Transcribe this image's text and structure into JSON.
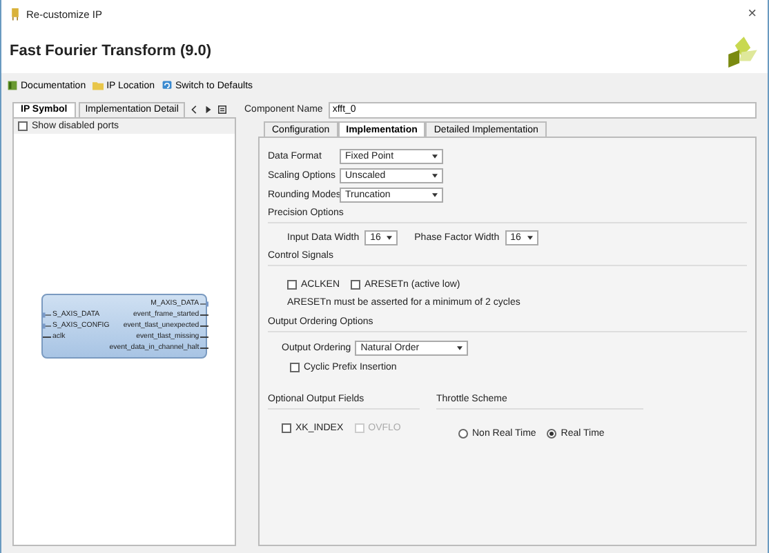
{
  "window": {
    "title": "Re-customize IP",
    "close": "×"
  },
  "header": {
    "title": "Fast Fourier Transform (9.0)"
  },
  "toolbar": [
    {
      "label": "Documentation"
    },
    {
      "label": "IP Location"
    },
    {
      "label": "Switch to Defaults"
    }
  ],
  "left_panel": {
    "tabs": [
      {
        "label": "IP Symbol",
        "selected": true
      },
      {
        "label": "Implementation Detail",
        "selected": false
      }
    ],
    "show_disabled_ports": {
      "label": "Show disabled ports",
      "checked": false
    },
    "symbol": {
      "left_ports": [
        {
          "label": "S_AXIS_DATA",
          "kind": "bus"
        },
        {
          "label": "S_AXIS_CONFIG",
          "kind": "bus"
        },
        {
          "label": "aclk",
          "kind": "wire"
        }
      ],
      "right_ports": [
        {
          "label": "M_AXIS_DATA",
          "kind": "bus"
        },
        {
          "label": "event_frame_started",
          "kind": "wire"
        },
        {
          "label": "event_tlast_unexpected",
          "kind": "wire"
        },
        {
          "label": "event_tlast_missing",
          "kind": "wire"
        },
        {
          "label": "event_data_in_channel_halt",
          "kind": "wire"
        }
      ]
    }
  },
  "component_name": {
    "label": "Component Name",
    "value": "xfft_0"
  },
  "tabs": [
    {
      "label": "Configuration",
      "selected": false
    },
    {
      "label": "Implementation",
      "selected": true
    },
    {
      "label": "Detailed Implementation",
      "selected": false
    }
  ],
  "dropdowns": [
    {
      "label": "Data Format",
      "value": "Fixed Point"
    },
    {
      "label": "Scaling Options",
      "value": "Unscaled"
    },
    {
      "label": "Rounding Modes",
      "value": "Truncation"
    }
  ],
  "precision_options": {
    "title": "Precision Options",
    "fields": [
      {
        "label": "Input Data Width",
        "value": "16"
      },
      {
        "label": "Phase Factor Width",
        "value": "16"
      }
    ]
  },
  "control_signals": {
    "title": "Control Signals",
    "checkboxes": [
      {
        "label": "ACLKEN",
        "checked": false,
        "disabled": false
      },
      {
        "label": "ARESETn (active low)",
        "checked": false,
        "disabled": false
      }
    ],
    "note": "ARESETn must be asserted for a minimum of 2 cycles"
  },
  "output_ordering": {
    "title": "Output Ordering Options",
    "label": "Output Ordering",
    "value": "Natural Order",
    "checkbox": {
      "label": "Cyclic Prefix Insertion",
      "checked": false,
      "disabled": false
    }
  },
  "optional_output_fields": {
    "title": "Optional Output Fields",
    "checkboxes": [
      {
        "label": "XK_INDEX",
        "checked": false,
        "disabled": false
      },
      {
        "label": "OVFLO",
        "checked": false,
        "disabled": true
      }
    ]
  },
  "throttle_scheme": {
    "title": "Throttle Scheme",
    "options": [
      {
        "label": "Non Real Time",
        "selected": false
      },
      {
        "label": "Real Time",
        "selected": true
      }
    ]
  }
}
